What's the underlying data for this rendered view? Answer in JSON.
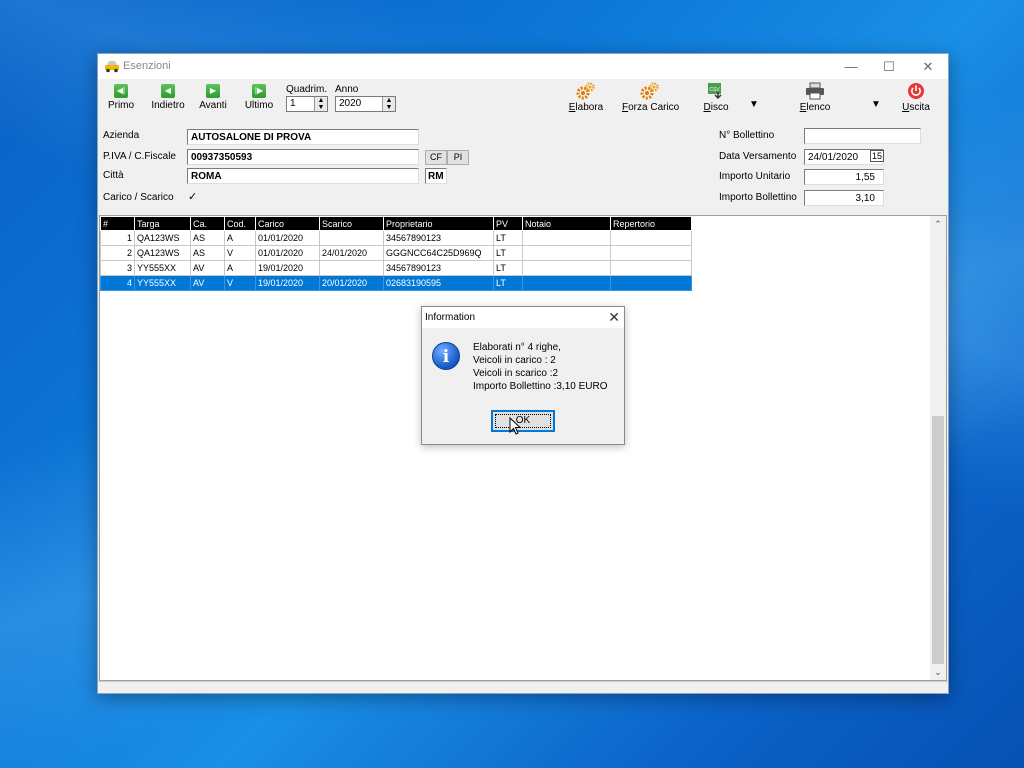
{
  "window": {
    "title": "Esenzioni"
  },
  "toolbar": {
    "primo": "Primo",
    "indietro": "Indietro",
    "avanti": "Avanti",
    "ultimo": "Ultimo",
    "quadrim_label": "Quadrim.",
    "quadrim_value": "1",
    "anno_label": "Anno",
    "anno_value": "2020",
    "elabora": "Elabora",
    "forza_carico": "Forza Carico",
    "disco": "Disco",
    "disco_badge": "CSV",
    "elenco": "Elenco",
    "uscita": "Uscita"
  },
  "form": {
    "azienda_label": "Azienda",
    "azienda_value": "AUTOSALONE DI PROVA",
    "piva_label": "P.IVA / C.Fiscale",
    "piva_value": "00937350593",
    "cf_button": "CF",
    "pi_button": "PI",
    "citta_label": "Città",
    "citta_value": "ROMA",
    "prov_value": "RM",
    "carico_label": "Carico / Scarico",
    "carico_checked": true,
    "bollettino_label": "N° Bollettino",
    "bollettino_value": "",
    "data_label": "Data Versamento",
    "data_value": "24/01/2020",
    "unitario_label": "Importo Unitario",
    "unitario_value": "1,55",
    "imp_boll_label": "Importo Bollettino",
    "imp_boll_value": "3,10"
  },
  "grid": {
    "columns": [
      "#",
      "Targa",
      "Ca.",
      "Cod.",
      "Carico",
      "Scarico",
      "Proprietario",
      "PV",
      "Notaio",
      "Repertorio"
    ],
    "rows": [
      [
        "1",
        "QA123WS",
        "AS",
        "A",
        "01/01/2020",
        "",
        "34567890123",
        "LT",
        "",
        ""
      ],
      [
        "2",
        "QA123WS",
        "AS",
        "V",
        "01/01/2020",
        "24/01/2020",
        "GGGNCC64C25D969Q",
        "LT",
        "",
        ""
      ],
      [
        "3",
        "YY555XX",
        "AV",
        "A",
        "19/01/2020",
        "",
        "34567890123",
        "LT",
        "",
        ""
      ],
      [
        "4",
        "YY555XX",
        "AV",
        "V",
        "19/01/2020",
        "20/01/2020",
        "02683190595",
        "LT",
        "",
        ""
      ]
    ],
    "selected_row": 3
  },
  "dialog": {
    "title": "Information",
    "lines": [
      "Elaborati n° 4 righe,",
      "Veicoli in carico : 2",
      "Veicoli in scarico :2",
      "Importo Bollettino :3,10 EURO"
    ],
    "ok": "OK"
  },
  "colors": {
    "selection": "#0078d7",
    "nav_green": "#3aa83a",
    "exit_red": "#e53935",
    "header_black": "#000000"
  },
  "icons": {
    "primo": "first-record-icon",
    "indietro": "previous-record-icon",
    "avanti": "next-record-icon",
    "ultimo": "last-record-icon",
    "elabora": "gears-icon",
    "forza_carico": "gears-icon",
    "disco": "csv-export-icon",
    "elenco": "printer-icon",
    "uscita": "power-icon",
    "info": "info-icon"
  }
}
